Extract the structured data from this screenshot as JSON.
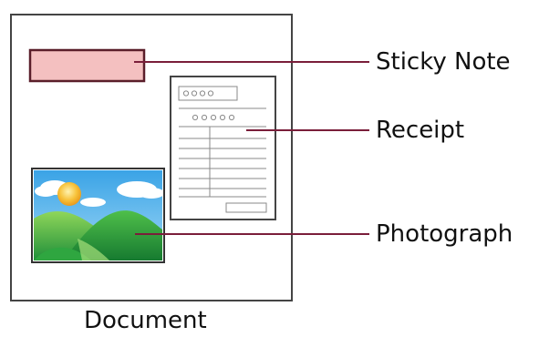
{
  "diagram": {
    "caption": "Document",
    "labels": {
      "sticky_note": "Sticky Note",
      "receipt": "Receipt",
      "photograph": "Photograph"
    }
  },
  "colors": {
    "outline": "#444444",
    "leader_line": "#7a1e3a",
    "sticky_fill": "#f4c0c0",
    "sticky_border": "#5a1e2a",
    "sky": "#3ba8e8",
    "sun": "#f7c23a",
    "hills_light": "#6cc34a",
    "hills_dark": "#1f8f3a",
    "cloud": "#ffffff",
    "receipt_lines": "#8a8a8a"
  }
}
